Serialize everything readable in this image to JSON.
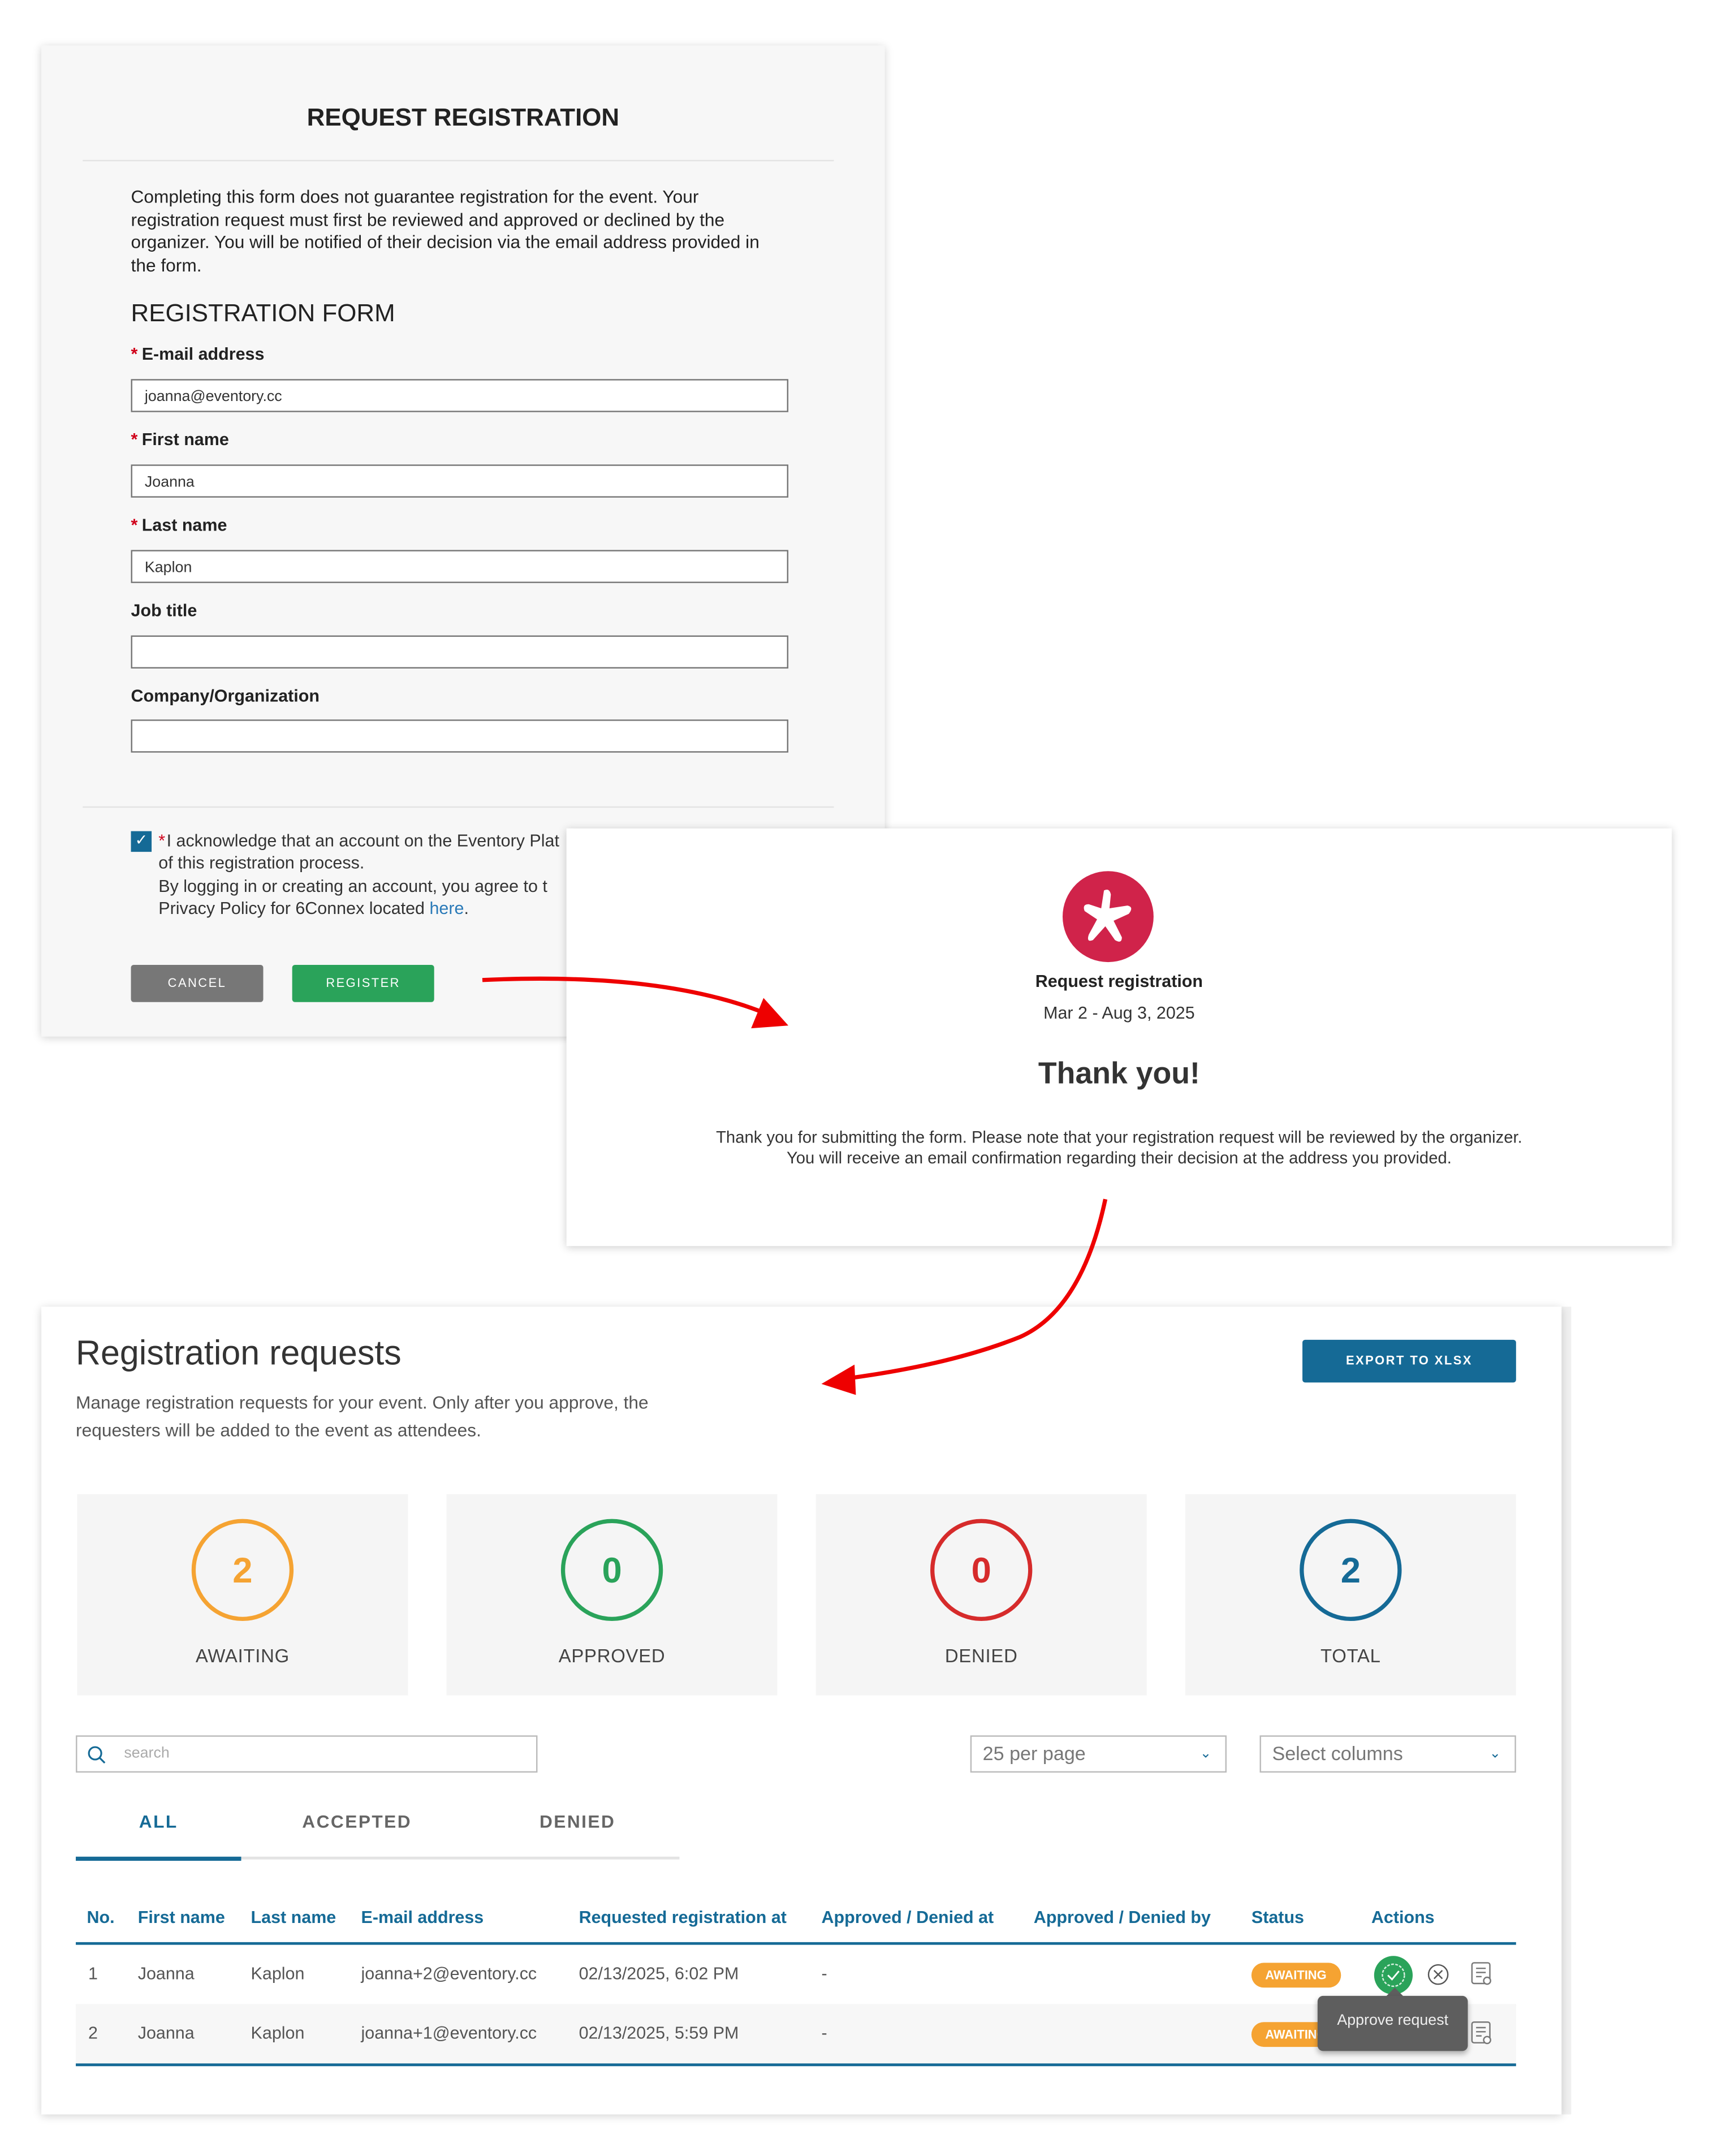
{
  "form": {
    "title": "REQUEST REGISTRATION",
    "intro": "Completing this form does not guarantee registration for the event. Your registration request must first be reviewed and approved or declined by the organizer. You will be notified of their decision via the email address provided in the form.",
    "section_title": "REGISTRATION FORM",
    "fields": [
      {
        "label": "E-mail address",
        "required": true,
        "value": "joanna@eventory.cc"
      },
      {
        "label": "First name",
        "required": true,
        "value": "Joanna"
      },
      {
        "label": "Last name",
        "required": true,
        "value": "Kaplon"
      },
      {
        "label": "Job title",
        "required": false,
        "value": ""
      },
      {
        "label": "Company/Organization",
        "required": false,
        "value": ""
      }
    ],
    "ack_checked": true,
    "ack_line1": "I acknowledge that an account on the Eventory Plat",
    "ack_line2": "of this registration process.",
    "ack_line3": "By logging in or creating an account, you agree to t",
    "ack_line4": "Privacy Policy for 6Connex located ",
    "ack_link": "here",
    "ack_end": ".",
    "cancel_label": "CANCEL",
    "register_label": "REGISTER"
  },
  "confirmation": {
    "event_name": "Request registration",
    "dates": "Mar 2 - Aug 3, 2025",
    "heading": "Thank you!",
    "message_line1": "Thank you for submitting the form. Please note that your registration request will be reviewed by the organizer.",
    "message_line2": "You will receive an email confirmation regarding their decision at the address you provided."
  },
  "requests": {
    "title": "Registration requests",
    "description_line1": "Manage registration requests for your event. Only after you approve, the",
    "description_line2": "requesters will be added to the event as attendees.",
    "export_label": "EXPORT TO XLSX",
    "stats": [
      {
        "value": "2",
        "label": "AWAITING",
        "color": "#f5a332"
      },
      {
        "value": "0",
        "label": "APPROVED",
        "color": "#2aa35a"
      },
      {
        "value": "0",
        "label": "DENIED",
        "color": "#d62b2b"
      },
      {
        "value": "2",
        "label": "TOTAL",
        "color": "#156a96"
      }
    ],
    "search_placeholder": "search",
    "per_page": "25 per page",
    "columns_select": "Select columns",
    "tabs": [
      "ALL",
      "ACCEPTED",
      "DENIED"
    ],
    "active_tab": "ALL",
    "headers": [
      "No.",
      "First name",
      "Last name",
      "E-mail address",
      "Requested registration at",
      "Approved / Denied at",
      "Approved / Denied by",
      "Status",
      "Actions"
    ],
    "rows": [
      {
        "no": "1",
        "first": "Joanna",
        "last": "Kaplon",
        "email": "joanna+2@eventory.cc",
        "requested": "02/13/2025, 6:02 PM",
        "decided_at": "-",
        "decided_by": "",
        "status": "AWAITING"
      },
      {
        "no": "2",
        "first": "Joanna",
        "last": "Kaplon",
        "email": "joanna+1@eventory.cc",
        "requested": "02/13/2025, 5:59 PM",
        "decided_at": "-",
        "decided_by": "",
        "status": "AWAITING"
      }
    ],
    "tooltip": "Approve request"
  },
  "colors": {
    "accent": "#156a96",
    "approve": "#2aa35a",
    "awaiting": "#f5a332",
    "brand": "#d0234a",
    "arrow": "#ee0000"
  }
}
